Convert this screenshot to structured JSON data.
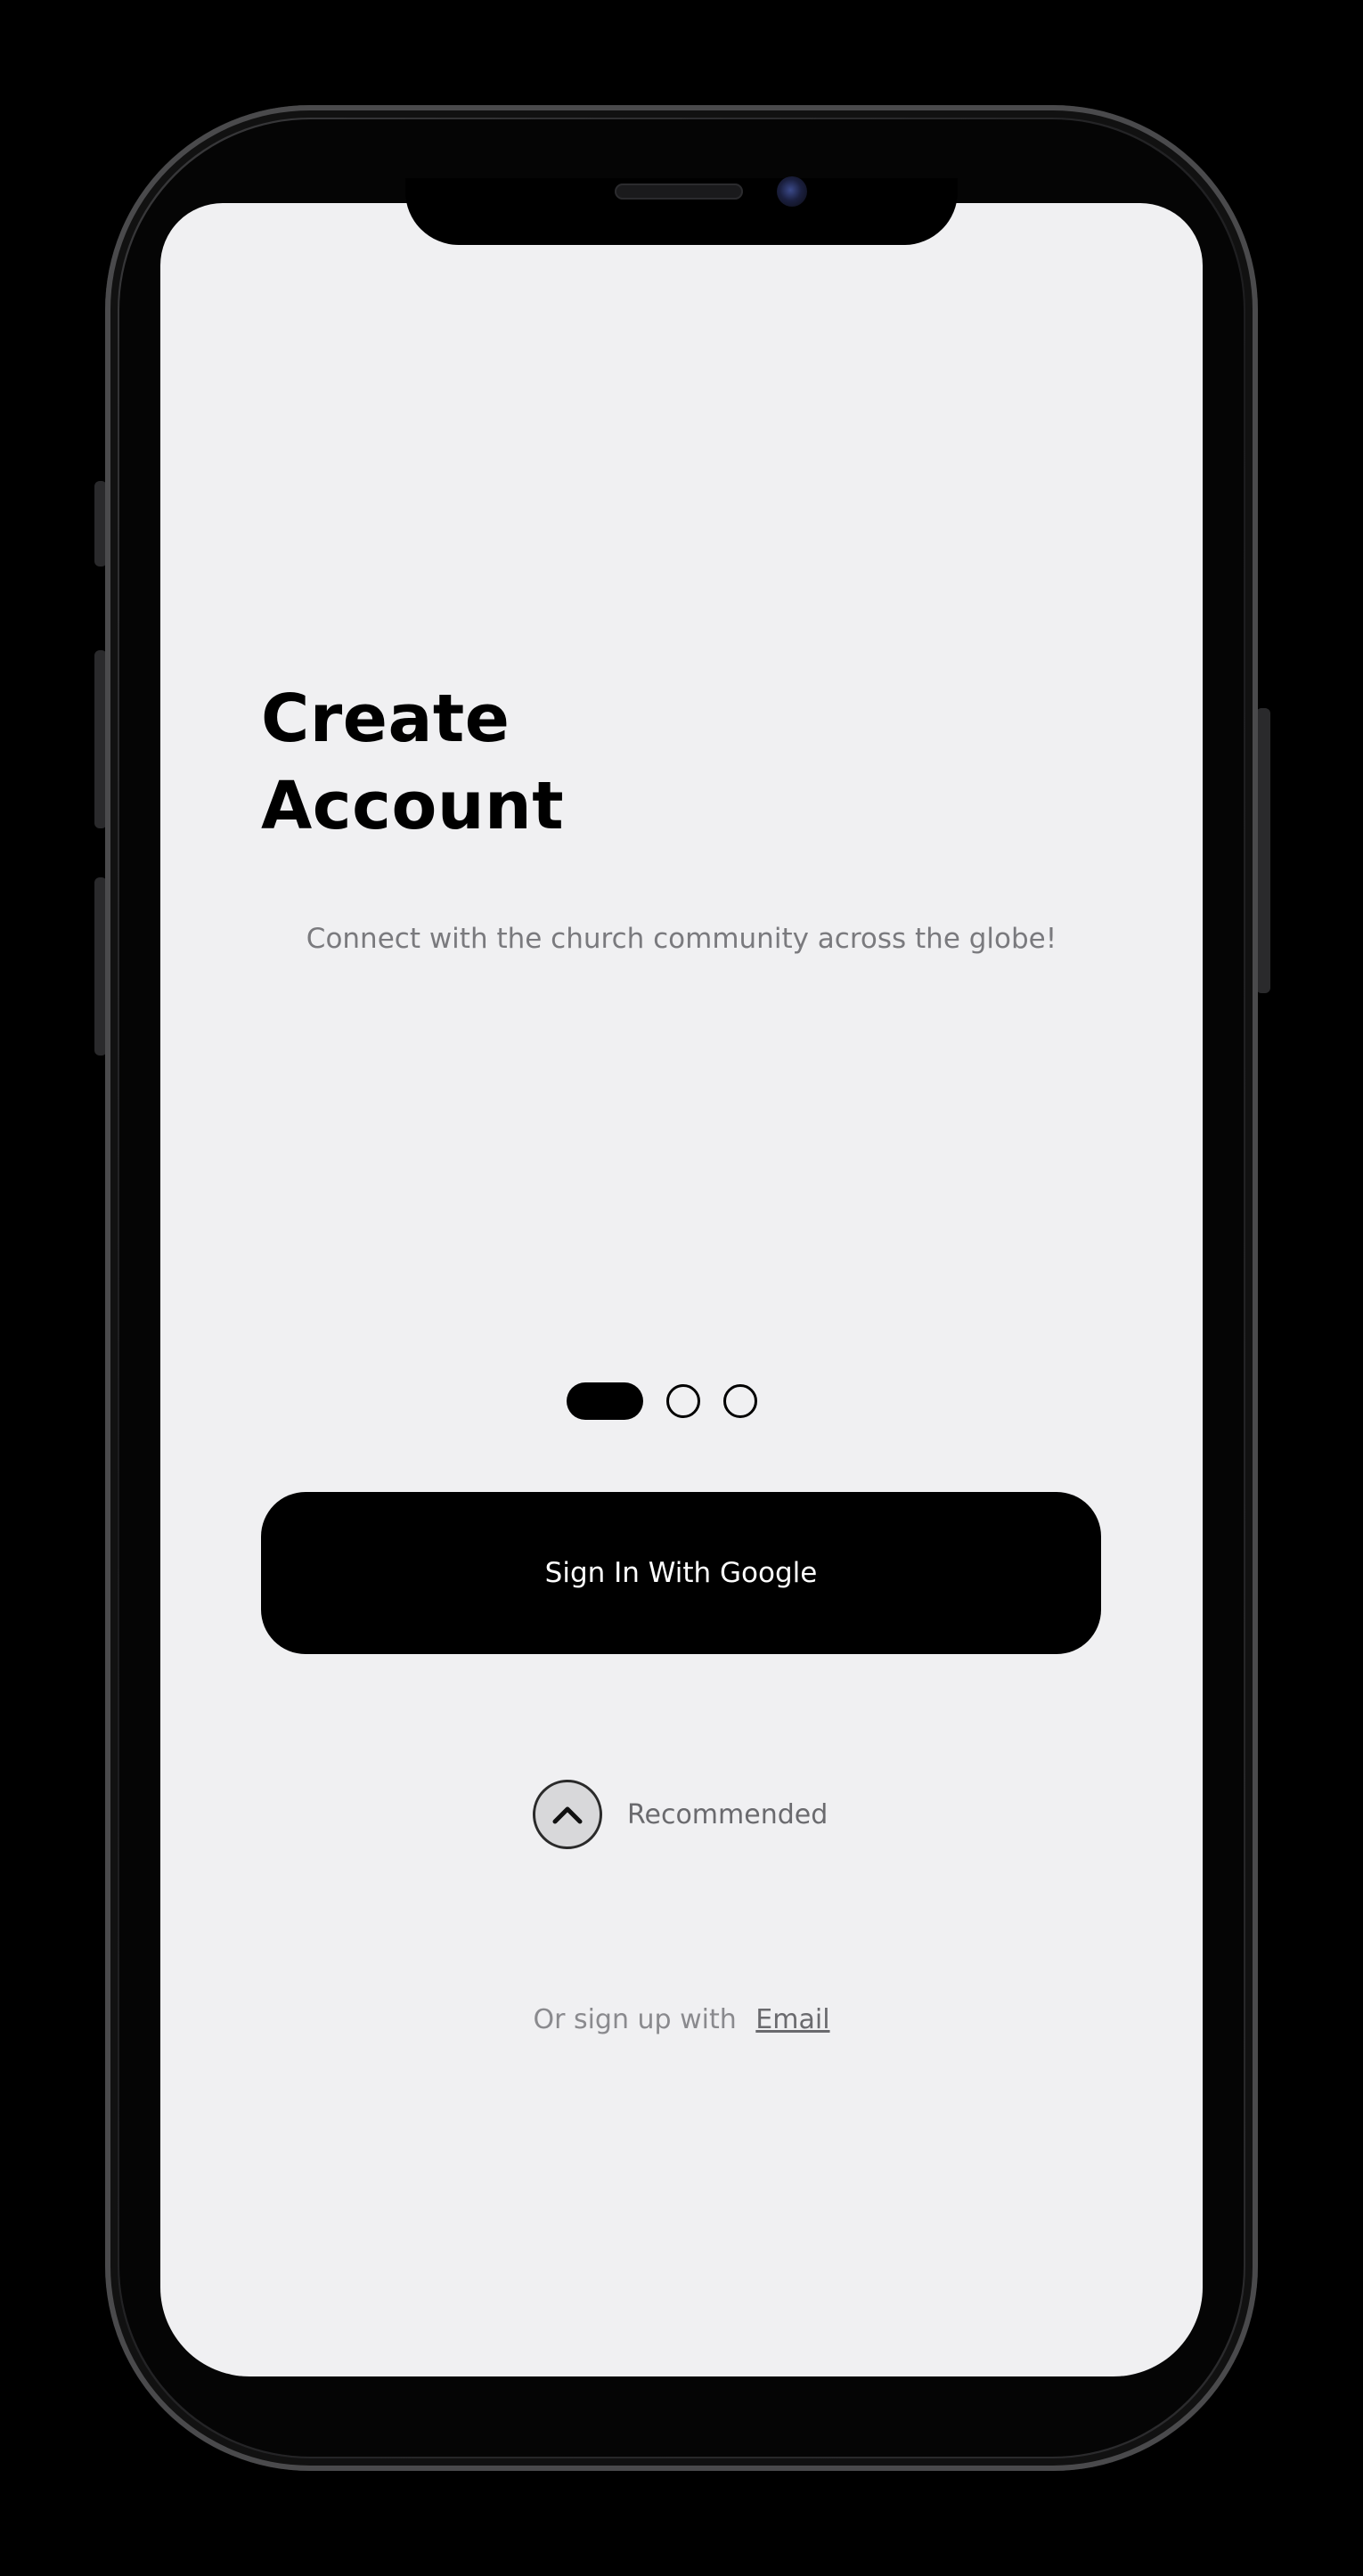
{
  "screen": {
    "title": "Create\nAccount",
    "subtitle": "Connect with the church community across the globe!"
  },
  "pager": {
    "page_count": 3,
    "active_index": 0
  },
  "actions": {
    "google_button_label": "Sign In With Google",
    "recommended_label": "Recommended",
    "recommended_icon": "chevron-up-icon",
    "signup_prefix": "Or sign up with",
    "signup_link_label": "Email"
  },
  "colors": {
    "background": "#f0f0f2",
    "primary": "#000000",
    "muted_text": "#7a7a7e"
  }
}
